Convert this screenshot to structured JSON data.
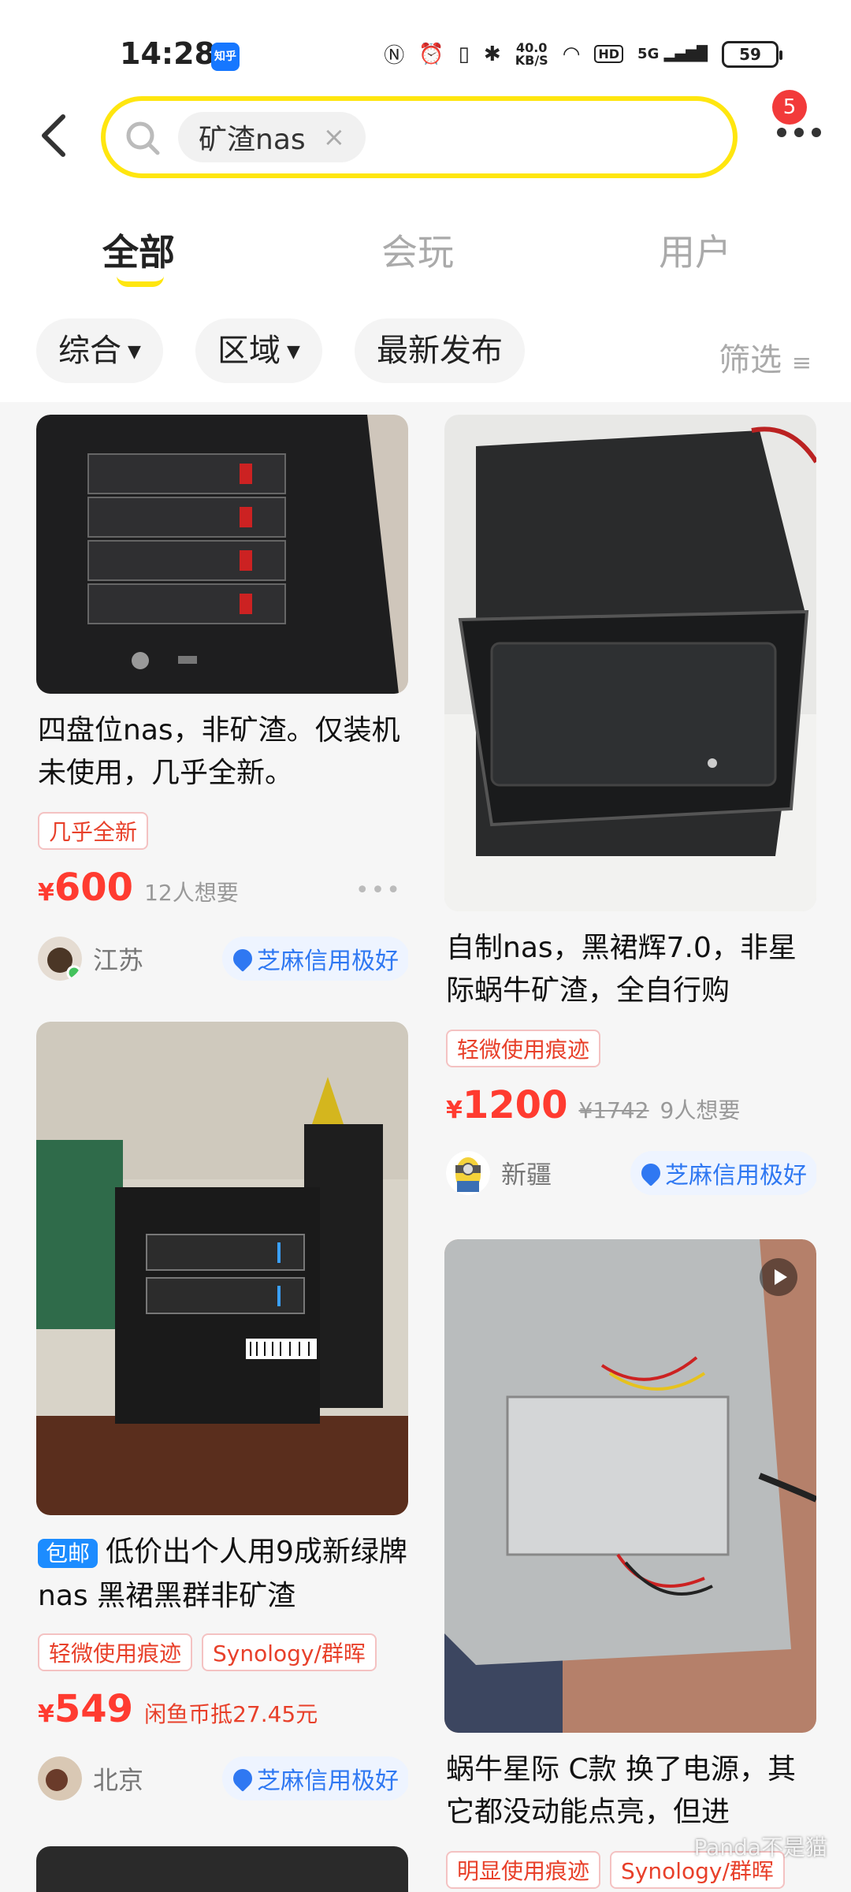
{
  "status_bar": {
    "time": "14:28",
    "app_badge": "知乎",
    "net_speed_top": "40.0",
    "net_speed_unit": "KB/S",
    "hd": "HD",
    "signal": "5G",
    "battery": "59"
  },
  "header": {
    "search_query": "矿渣nas",
    "chip_close": "×",
    "badge_count": "5"
  },
  "tabs": [
    {
      "label": "全部",
      "active": true
    },
    {
      "label": "会玩",
      "active": false
    },
    {
      "label": "用户",
      "active": false
    }
  ],
  "filters": {
    "sort": "综合",
    "region": "区域",
    "latest": "最新发布",
    "screen": "筛选"
  },
  "items": [
    {
      "title": "四盘位nas，非矿渣。仅装机未使用，几乎全新。",
      "tags": [
        "几乎全新"
      ],
      "price": "600",
      "currency": "¥",
      "wants": "12人想要",
      "region": "江苏",
      "credit": "芝麻信用极好"
    },
    {
      "title": "自制nas，黑裙辉7.0，非星际蜗牛矿渣，全自行购",
      "tags": [
        "轻微使用痕迹"
      ],
      "price": "1200",
      "currency": "¥",
      "original_price": "¥1742",
      "wants": "9人想要",
      "region": "新疆",
      "credit": "芝麻信用极好"
    },
    {
      "shipping": "包邮",
      "title": "低价出个人用9成新绿牌nas 黑裙黑群非矿渣",
      "tags": [
        "轻微使用痕迹",
        "Synology/群晖"
      ],
      "price": "549",
      "currency": "¥",
      "coin_offset": "闲鱼币抵27.45元",
      "region": "北京",
      "credit": "芝麻信用极好"
    },
    {
      "title": "蜗牛星际 C款 换了电源，其它都没动能点亮，但进",
      "tags": [
        "明显使用痕迹",
        "Synology/群晖"
      ]
    }
  ],
  "watermark": "Panda不是猫"
}
